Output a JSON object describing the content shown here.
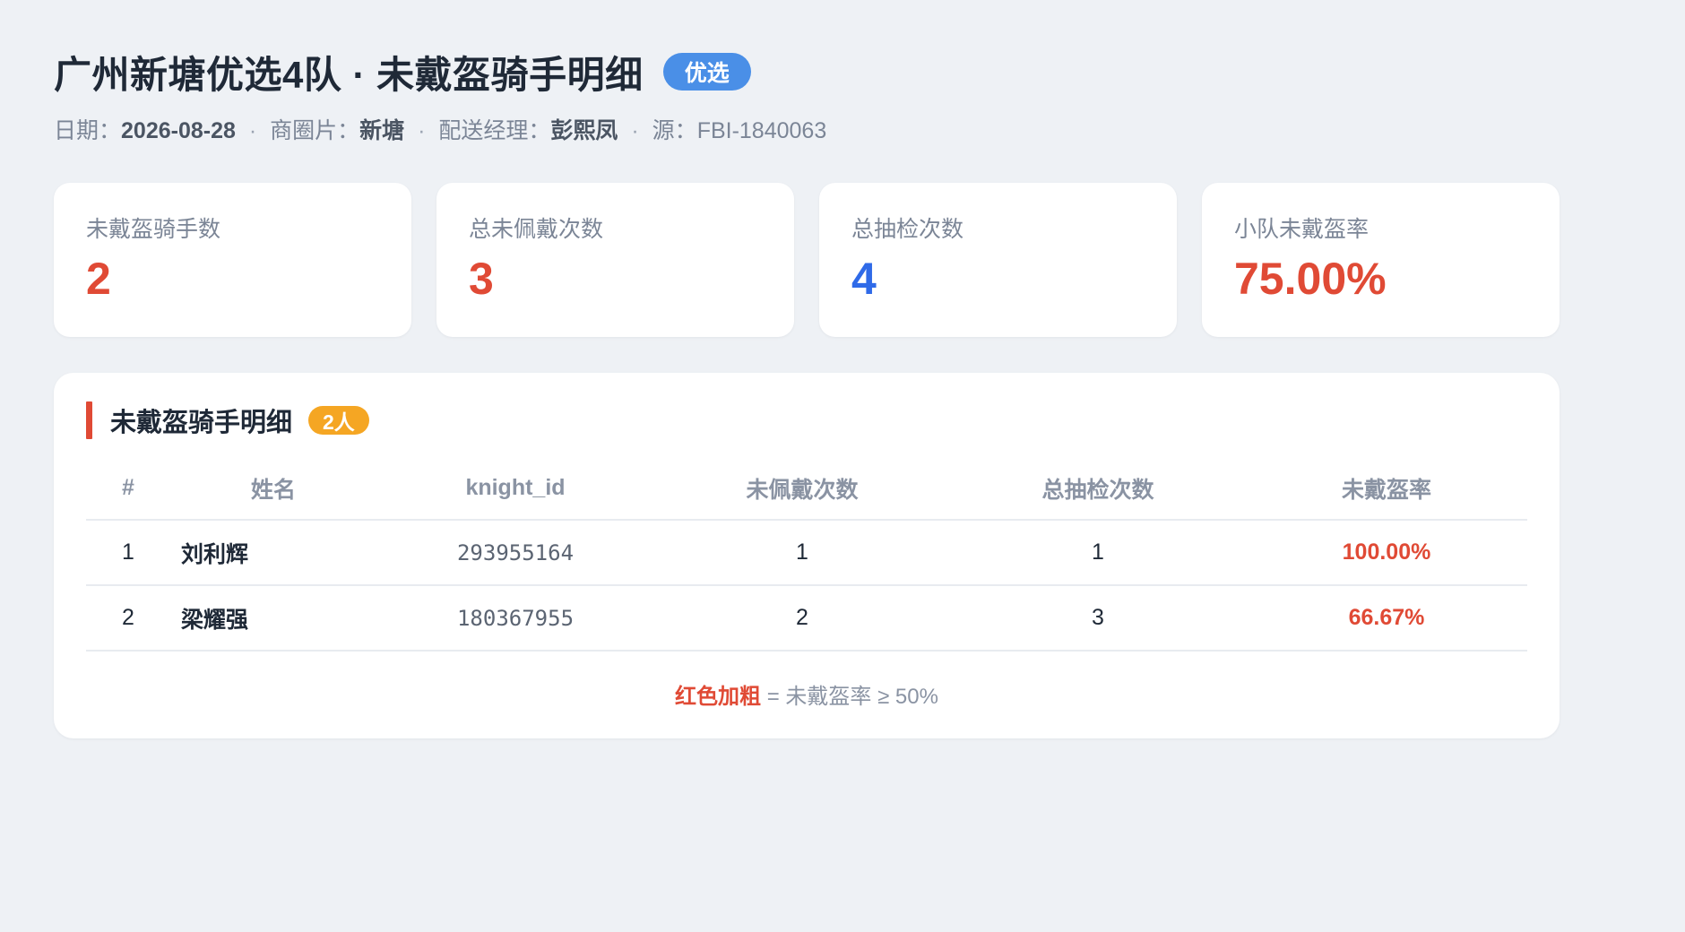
{
  "header": {
    "title": "广州新塘优选4队 · 未戴盔骑手明细",
    "badge": "优选",
    "meta": {
      "date_label": "日期：",
      "date": "2026-08-28",
      "area_label": "商圈片：",
      "area": "新塘",
      "manager_label": "配送经理：",
      "manager": "彭熙凤",
      "source_label": "源：",
      "source": "FBI-1840063",
      "separator": "·"
    }
  },
  "stats": [
    {
      "label": "未戴盔骑手数",
      "value": "2",
      "color": "#e04a35"
    },
    {
      "label": "总未佩戴次数",
      "value": "3",
      "color": "#e04a35"
    },
    {
      "label": "总抽检次数",
      "value": "4",
      "color": "#2f6ae8"
    },
    {
      "label": "小队未戴盔率",
      "value": "75.00%",
      "color": "#e04a35"
    }
  ],
  "detail": {
    "title": "未戴盔骑手明细",
    "count_badge": "2人",
    "columns": [
      "#",
      "姓名",
      "knight_id",
      "未佩戴次数",
      "总抽检次数",
      "未戴盔率"
    ],
    "rows": [
      {
        "idx": "1",
        "name": "刘利辉",
        "knight_id": "293955164",
        "missed": "1",
        "total": "1",
        "rate": "100.00%"
      },
      {
        "idx": "2",
        "name": "梁耀强",
        "knight_id": "180367955",
        "missed": "2",
        "total": "3",
        "rate": "66.67%"
      }
    ],
    "footnote": {
      "highlight": "红色加粗",
      "text": " = 未戴盔率 ≥ 50%"
    }
  }
}
